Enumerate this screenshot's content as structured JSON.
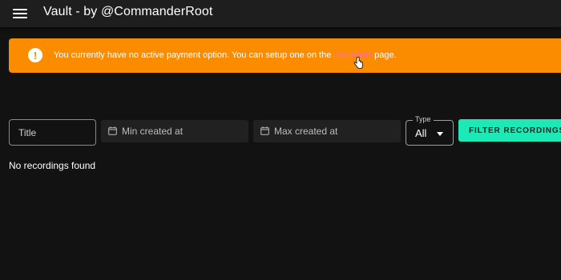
{
  "appbar": {
    "title": "Vault - by @CommanderRoot",
    "menu_icon": "hamburger-menu-icon"
  },
  "alert": {
    "icon": "exclamation-icon",
    "text_before": "You currently have no active payment option. You can setup one on the ",
    "link_text": "payments",
    "text_after": " page.",
    "background_color": "#fb8c00",
    "link_color": "#ff6fa8"
  },
  "filters": {
    "title_placeholder": "Title",
    "min_created_placeholder": "Min created at",
    "max_created_placeholder": "Max created at",
    "type_label": "Type",
    "type_value": "All",
    "filter_button": "FILTER RECORDINGS",
    "button_color": "#1de9b6"
  },
  "results": {
    "empty_message": "No recordings found"
  }
}
